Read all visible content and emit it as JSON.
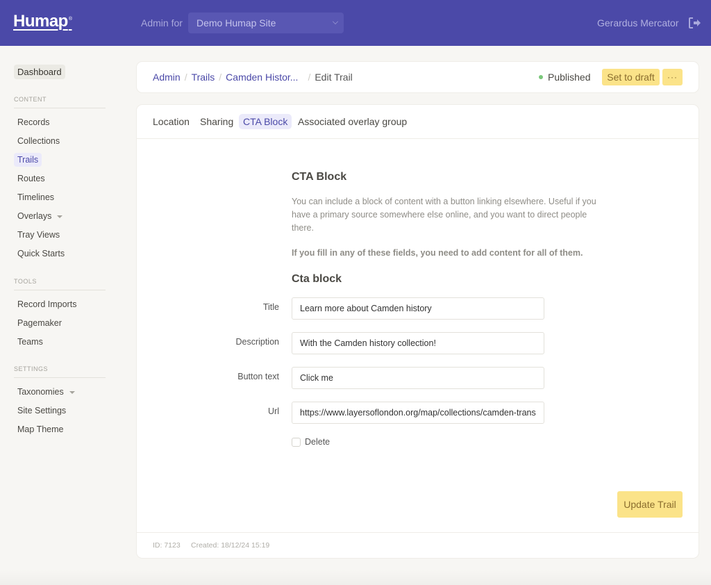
{
  "topbar": {
    "logo": "Humap",
    "logo_mark": "®",
    "admin_for_label": "Admin for",
    "site_select_value": "Demo Humap Site",
    "user_name": "Gerardus Mercator",
    "logout_icon": "logout-icon",
    "brand_color": "#4b49a8"
  },
  "sidebar": {
    "dashboard": "Dashboard",
    "sections": [
      {
        "title": "CONTENT",
        "items": [
          {
            "label": "Records"
          },
          {
            "label": "Collections"
          },
          {
            "label": "Trails",
            "active": true
          },
          {
            "label": "Routes"
          },
          {
            "label": "Timelines"
          },
          {
            "label": "Overlays",
            "has_dropdown": true
          },
          {
            "label": "Tray Views"
          },
          {
            "label": "Quick Starts"
          }
        ]
      },
      {
        "title": "TOOLS",
        "items": [
          {
            "label": "Record Imports"
          },
          {
            "label": "Pagemaker"
          },
          {
            "label": "Teams"
          }
        ]
      },
      {
        "title": "SETTINGS",
        "items": [
          {
            "label": "Taxonomies",
            "has_dropdown": true
          },
          {
            "label": "Site Settings"
          },
          {
            "label": "Map Theme"
          }
        ]
      }
    ]
  },
  "header": {
    "breadcrumb": [
      {
        "label": "Admin",
        "link": true
      },
      {
        "label": "Trails",
        "link": true
      },
      {
        "label": "Camden Histor...",
        "link": true
      },
      {
        "label": "Edit Trail",
        "link": false
      }
    ],
    "status": "Published",
    "status_color": "#7ac77a",
    "set_draft_label": "Set to draft",
    "more_label": "···"
  },
  "tabs": [
    {
      "label": "Location"
    },
    {
      "label": "Sharing"
    },
    {
      "label": "CTA Block",
      "active": true
    },
    {
      "label": "Associated overlay group"
    }
  ],
  "form": {
    "heading": "CTA Block",
    "help_text": "You can include a block of content with a button linking elsewhere. Useful if you have a primary source somewhere else online, and you want to direct people there.",
    "help_warning": "If you fill in any of these fields, you need to add content for all of them.",
    "subheading": "Cta block",
    "fields": [
      {
        "label": "Title",
        "value": "Learn more about Camden history"
      },
      {
        "label": "Description",
        "value": "With the Camden history collection!"
      },
      {
        "label": "Button text",
        "value": "Click me"
      },
      {
        "label": "Url",
        "value": "https://www.layersoflondon.org/map/collections/camden-trans"
      }
    ],
    "delete_label": "Delete",
    "delete_checked": false,
    "submit_label": "Update Trail"
  },
  "footer": {
    "id": "ID: 7123",
    "created": "Created: 18/12/24 15:19"
  }
}
